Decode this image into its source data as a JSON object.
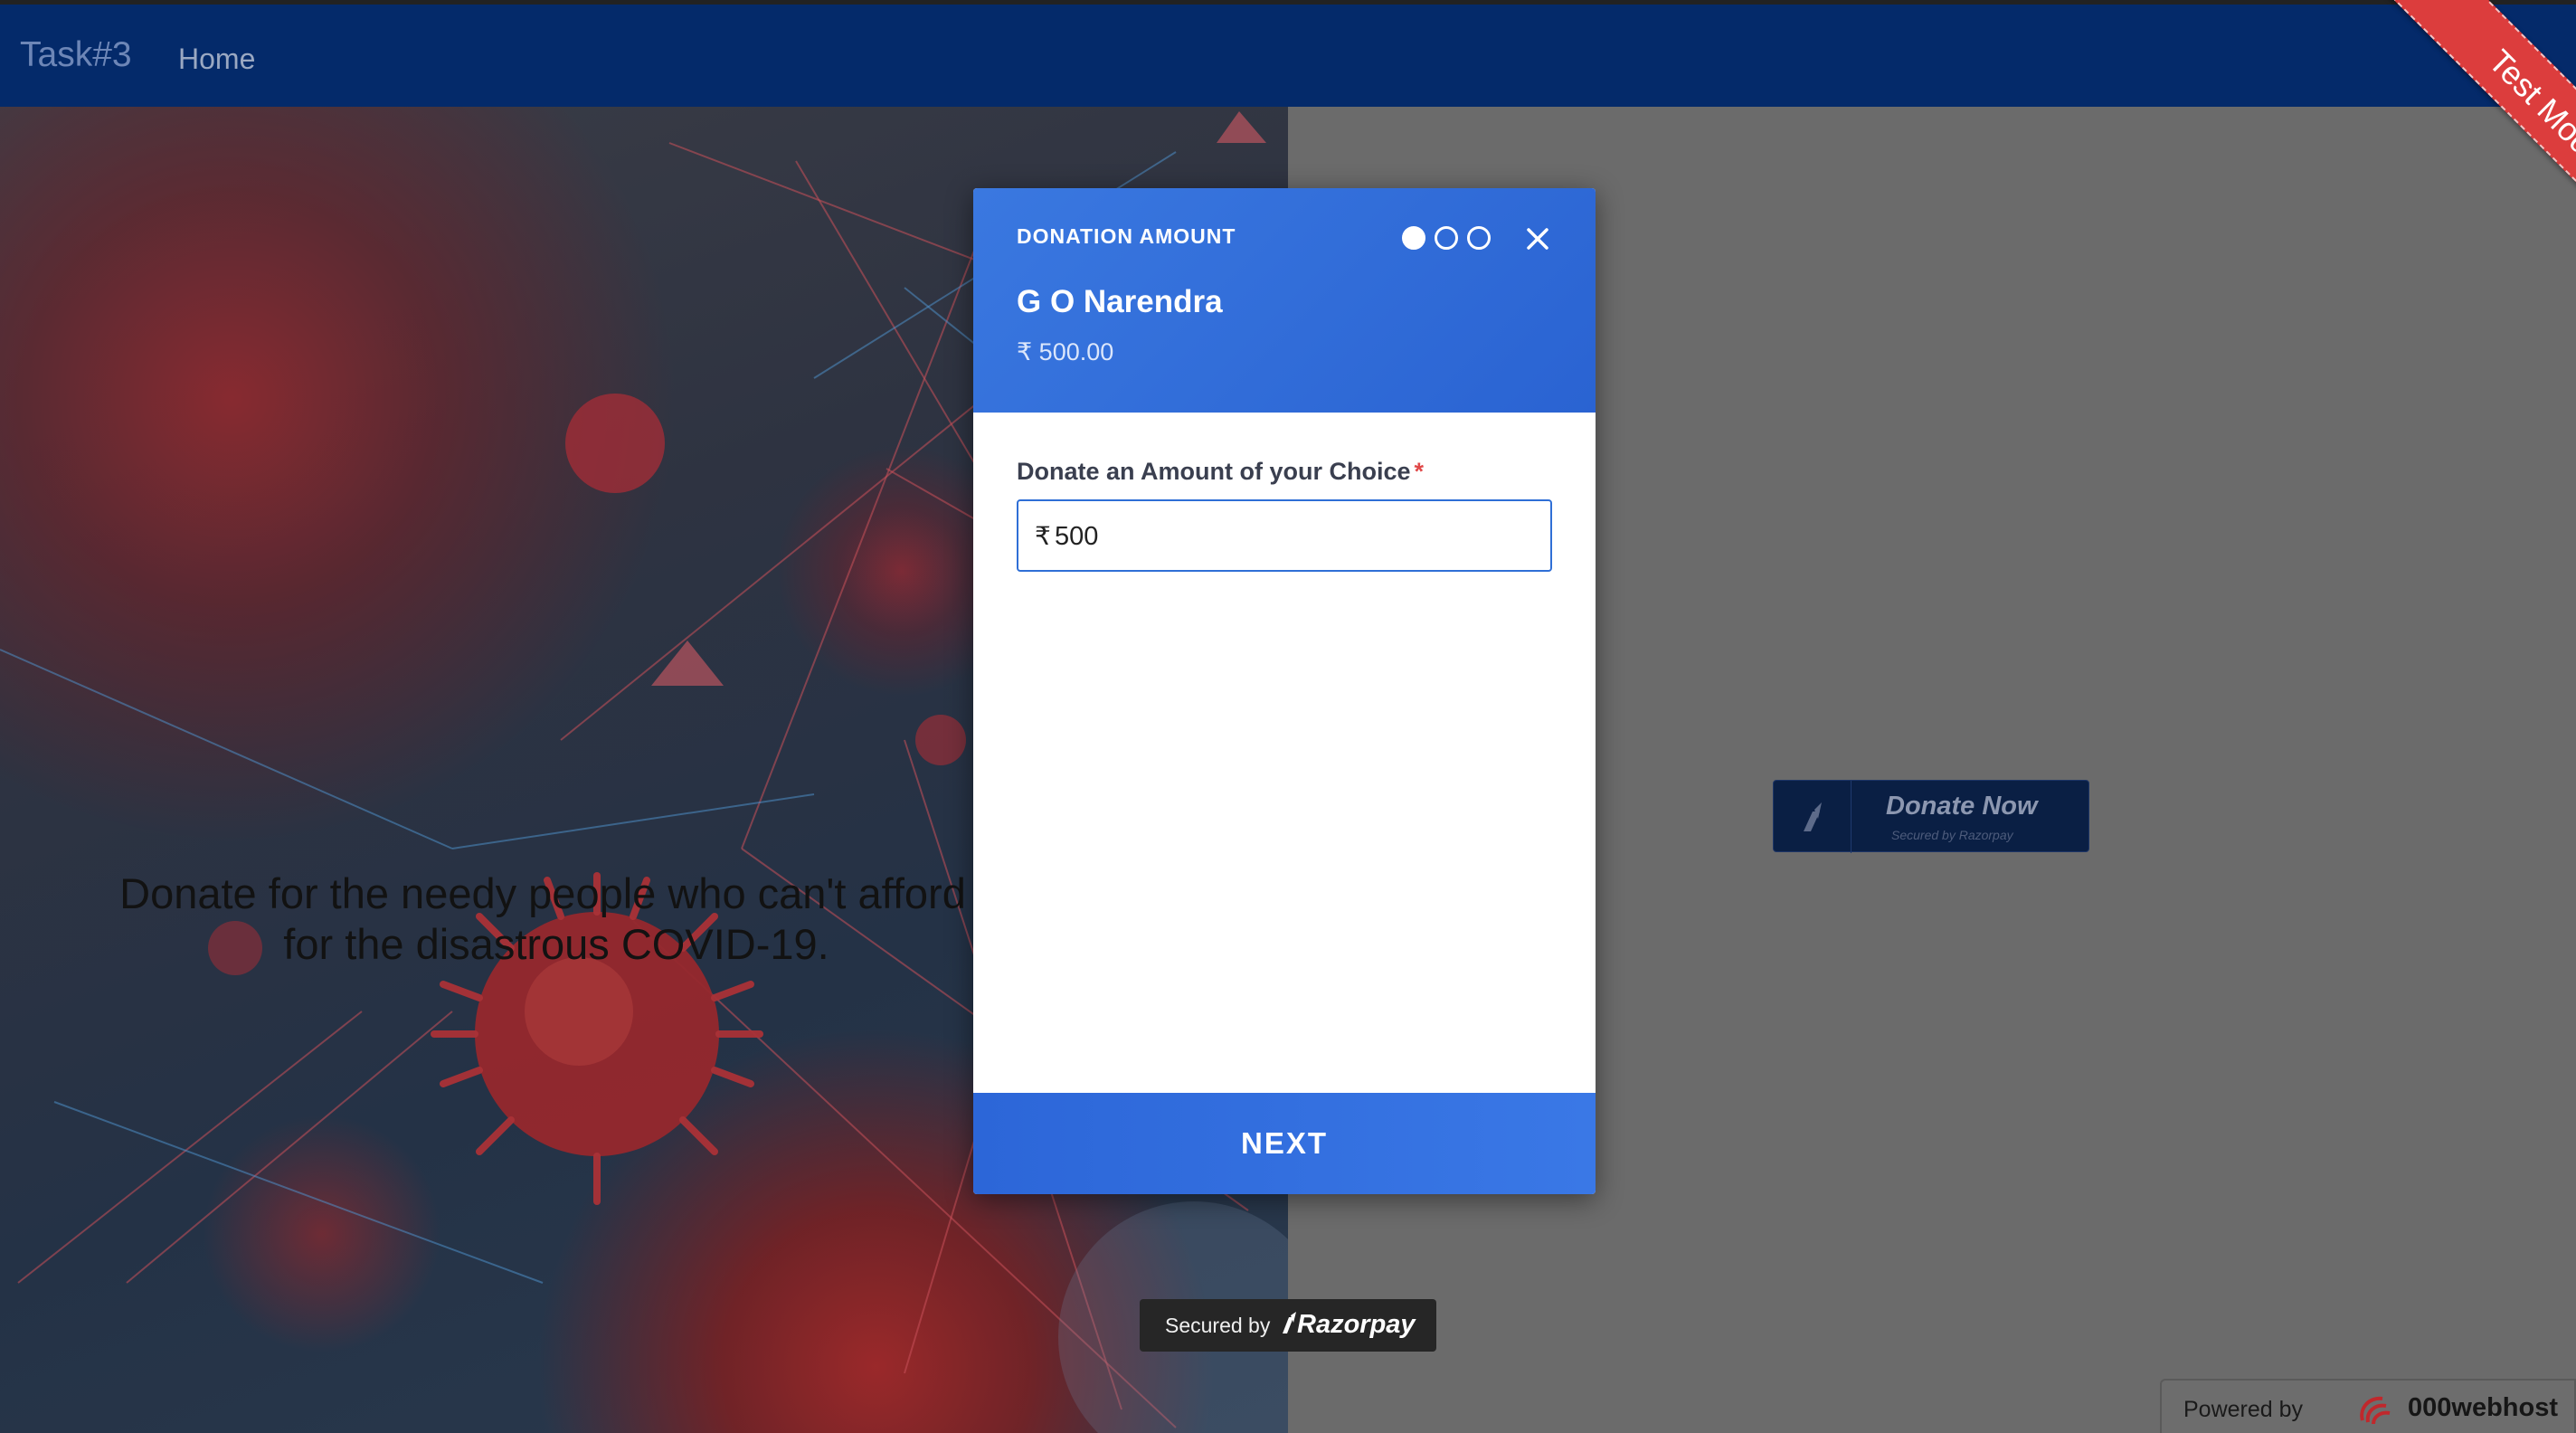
{
  "navbar": {
    "brand": "Task#3",
    "home_link": "Home"
  },
  "ribbon": {
    "label": "Test Mode"
  },
  "hero": {
    "text_line1": "Donate for the needy people who can't afford",
    "text_line2": "for the disastrous COVID-19."
  },
  "donate_button": {
    "label": "Donate Now",
    "sublabel": "Secured by Razorpay"
  },
  "modal": {
    "step_label": "DONATION AMOUNT",
    "steps_total": 3,
    "current_step": 1,
    "merchant_name": "G O Narendra",
    "amount_display": "₹ 500.00",
    "field_label": "Donate an Amount of your Choice",
    "required_mark": "*",
    "currency_symbol": "₹",
    "amount_value": "500",
    "next_label": "NEXT"
  },
  "secured_badge": {
    "prefix": "Secured by",
    "brand": "Razorpay"
  },
  "powered_by": {
    "prefix": "Powered by",
    "brand": "000webhost"
  },
  "colors": {
    "navbar": "#042a6a",
    "modal_accent": "#2f6fd6",
    "ribbon": "#dc3d3d"
  }
}
